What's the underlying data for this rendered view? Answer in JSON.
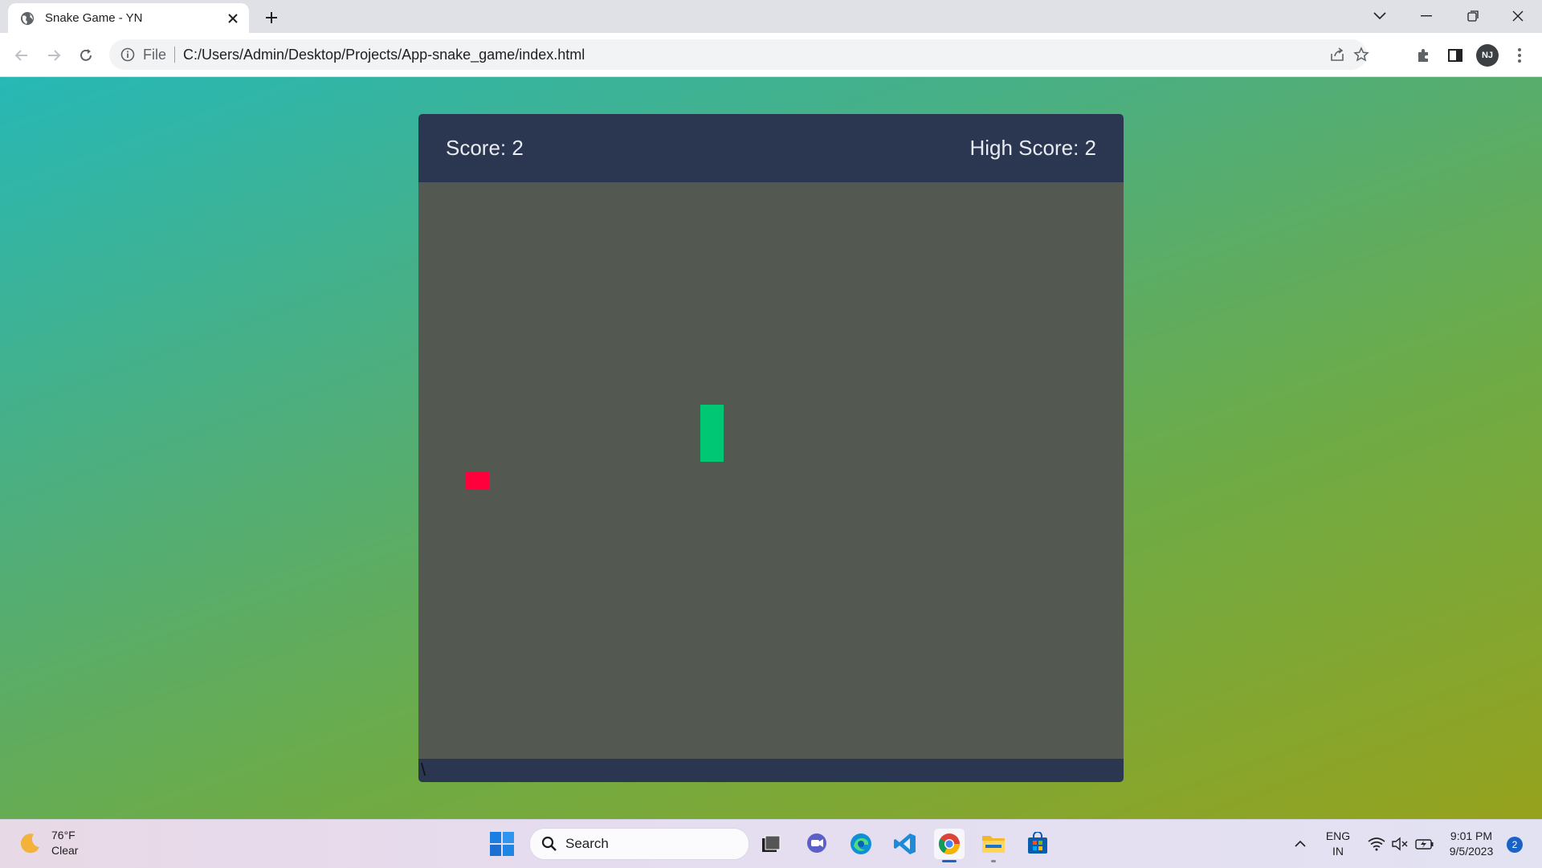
{
  "browser": {
    "tab_title": "Snake Game - YN",
    "address_chip": "File",
    "url": "C:/Users/Admin/Desktop/Projects/App-snake_game/index.html",
    "profile_initials": "NJ"
  },
  "game": {
    "score_text": "Score: 2",
    "high_score_text": "High Score: 2",
    "score": 2,
    "high_score": 2,
    "footer_glyph": "\\",
    "colors": {
      "panel": "#2b3651",
      "board": "#535851",
      "food": "#ff003d",
      "snake": "#00c773"
    }
  },
  "taskbar": {
    "weather_temp": "76°F",
    "weather_desc": "Clear",
    "search_label": "Search",
    "lang_top": "ENG",
    "lang_bottom": "IN",
    "time": "9:01 PM",
    "date": "9/5/2023",
    "notification_count": "2"
  }
}
